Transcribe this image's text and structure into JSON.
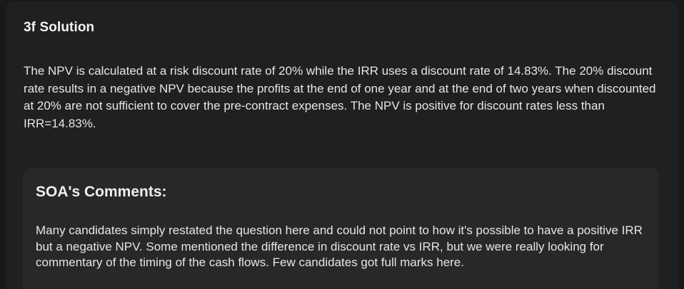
{
  "solution": {
    "title": "3f Solution",
    "body": "The NPV is calculated at a risk discount rate of 20% while the IRR uses a discount rate of 14.83%. The 20% discount rate results in a negative NPV because the profits at the end of one year and at the end of two years when discounted at 20% are not sufficient to cover the pre-contract expenses. The NPV is positive for discount rates less than IRR=14.83%."
  },
  "comments": {
    "title": "SOA's Comments:",
    "body": "Many candidates simply restated the question here and could not point to how it's possible to have a positive IRR but a negative NPV. Some mentioned the difference in discount rate vs IRR, but we were really looking for commentary of the timing of the cash flows. Few candidates got full marks here."
  },
  "colors": {
    "page_background": "#18191b",
    "card_background": "#1f2022",
    "comments_background": "#27282a",
    "text": "#e6e6e6"
  }
}
